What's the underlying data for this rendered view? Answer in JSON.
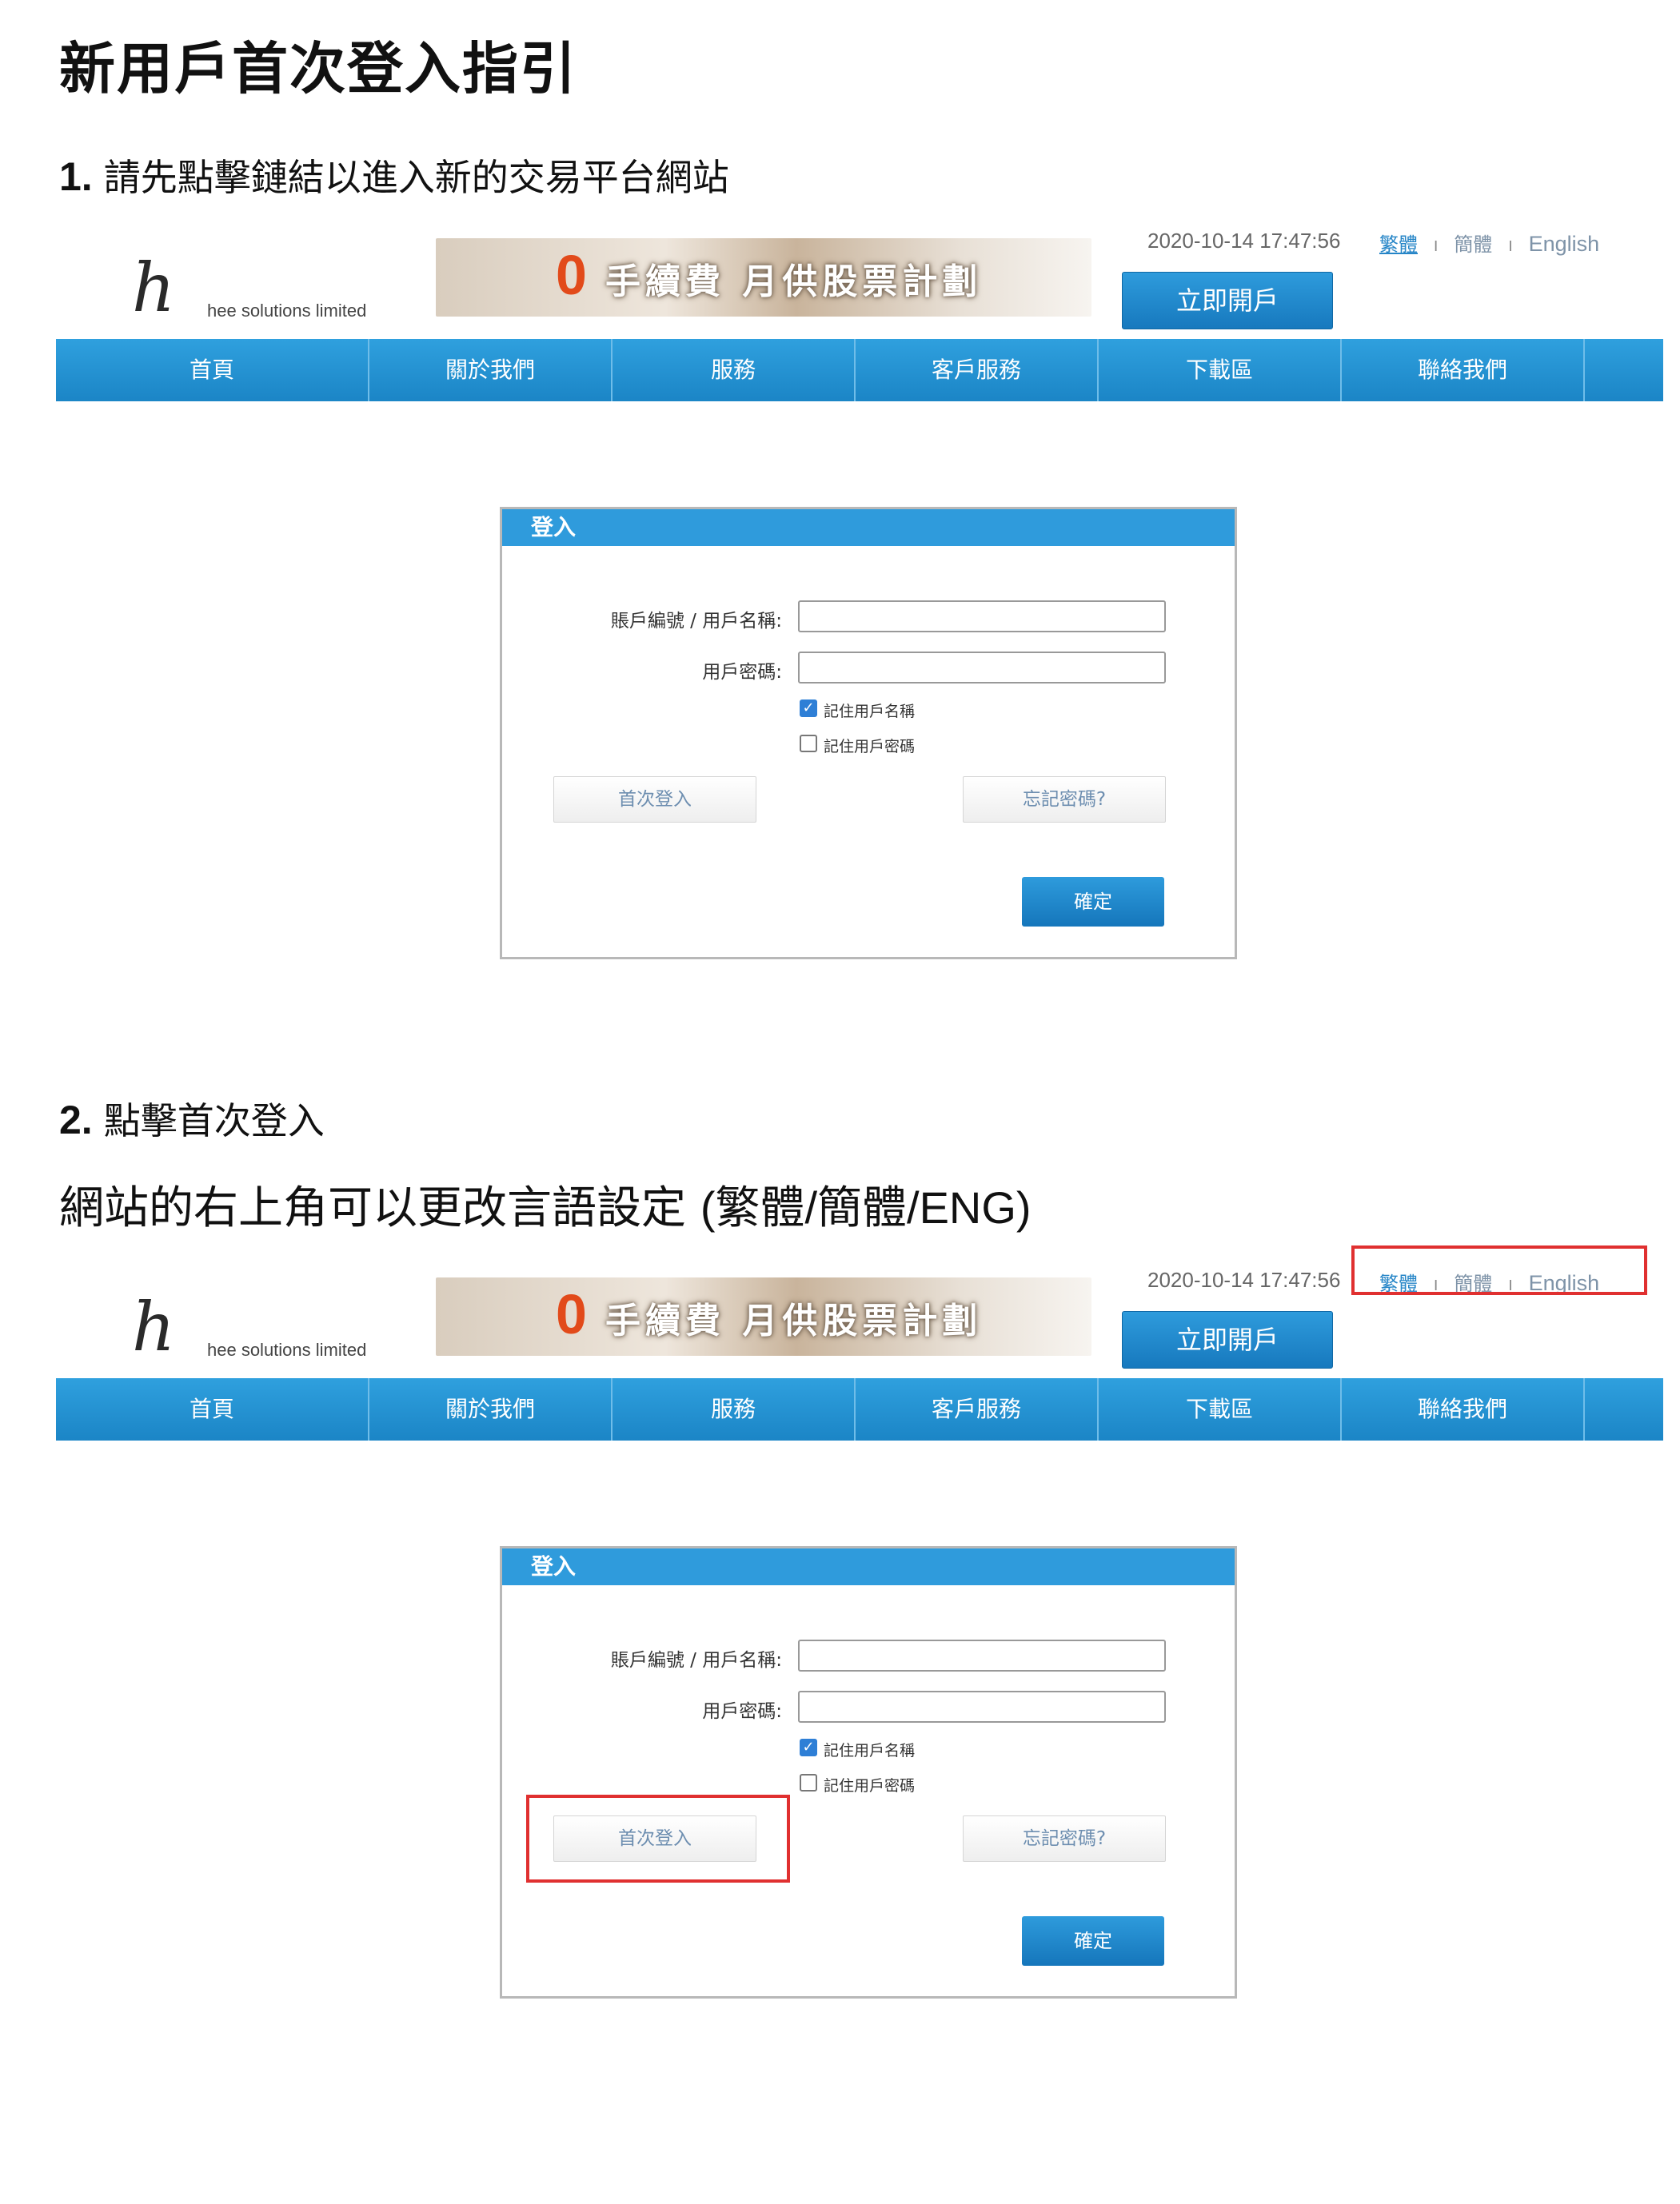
{
  "title": "新用戶首次登入指引",
  "step1": {
    "number": "1.",
    "text": "請先點擊鏈結以進入新的交易平台網站"
  },
  "step2": {
    "number": "2.",
    "text": "點擊首次登入"
  },
  "lang_note": {
    "text": "網站的右上角可以更改言語設定",
    "suffix": "(繁體/簡體/ENG)"
  },
  "site": {
    "logo_mark": "h",
    "logo_text": "hee solutions limited",
    "banner_zero": "0",
    "banner_text": "手續費 月供股票計劃",
    "datetime": "2020-10-14 17:47:56",
    "lang_traditional": "繁體",
    "lang_simplified": "簡體",
    "lang_english": "English",
    "lang_separator": "I",
    "open_account": "立即開戶",
    "nav": [
      "首頁",
      "關於我們",
      "服務",
      "客戶服務",
      "下載區",
      "聯絡我們"
    ],
    "login": {
      "title": "登入",
      "account_label": "賬戶編號 / 用戶名稱:",
      "account_value": "",
      "password_label": "用戶密碼:",
      "password_value": "",
      "remember_user": "記住用戶名稱",
      "remember_user_checked": true,
      "remember_password": "記住用戶密碼",
      "remember_password_checked": false,
      "first_login": "首次登入",
      "forgot_password": "忘記密碼?",
      "confirm": "確定"
    }
  },
  "colors": {
    "nav_blue": "#1f8fd3",
    "highlight_red": "#e03030",
    "banner_zero": "#e24a1a"
  }
}
